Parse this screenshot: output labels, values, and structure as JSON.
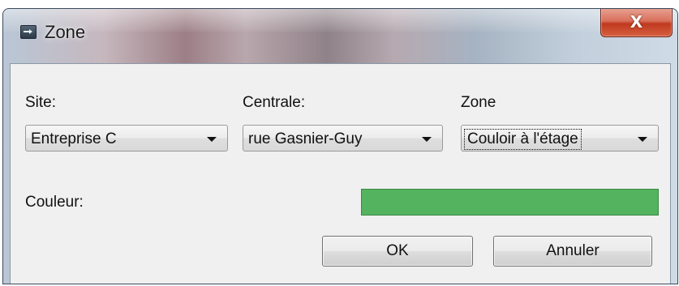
{
  "window": {
    "title": "Zone",
    "close_glyph": "X"
  },
  "fields": {
    "site": {
      "label": "Site:",
      "value": "Entreprise C"
    },
    "centrale": {
      "label": "Centrale:",
      "value": "rue Gasnier-Guy"
    },
    "zone": {
      "label": "Zone",
      "value": "Couloir à l'étage"
    }
  },
  "color": {
    "label": "Couleur:",
    "value": "#54b35e"
  },
  "buttons": {
    "ok": "OK",
    "cancel": "Annuler"
  }
}
